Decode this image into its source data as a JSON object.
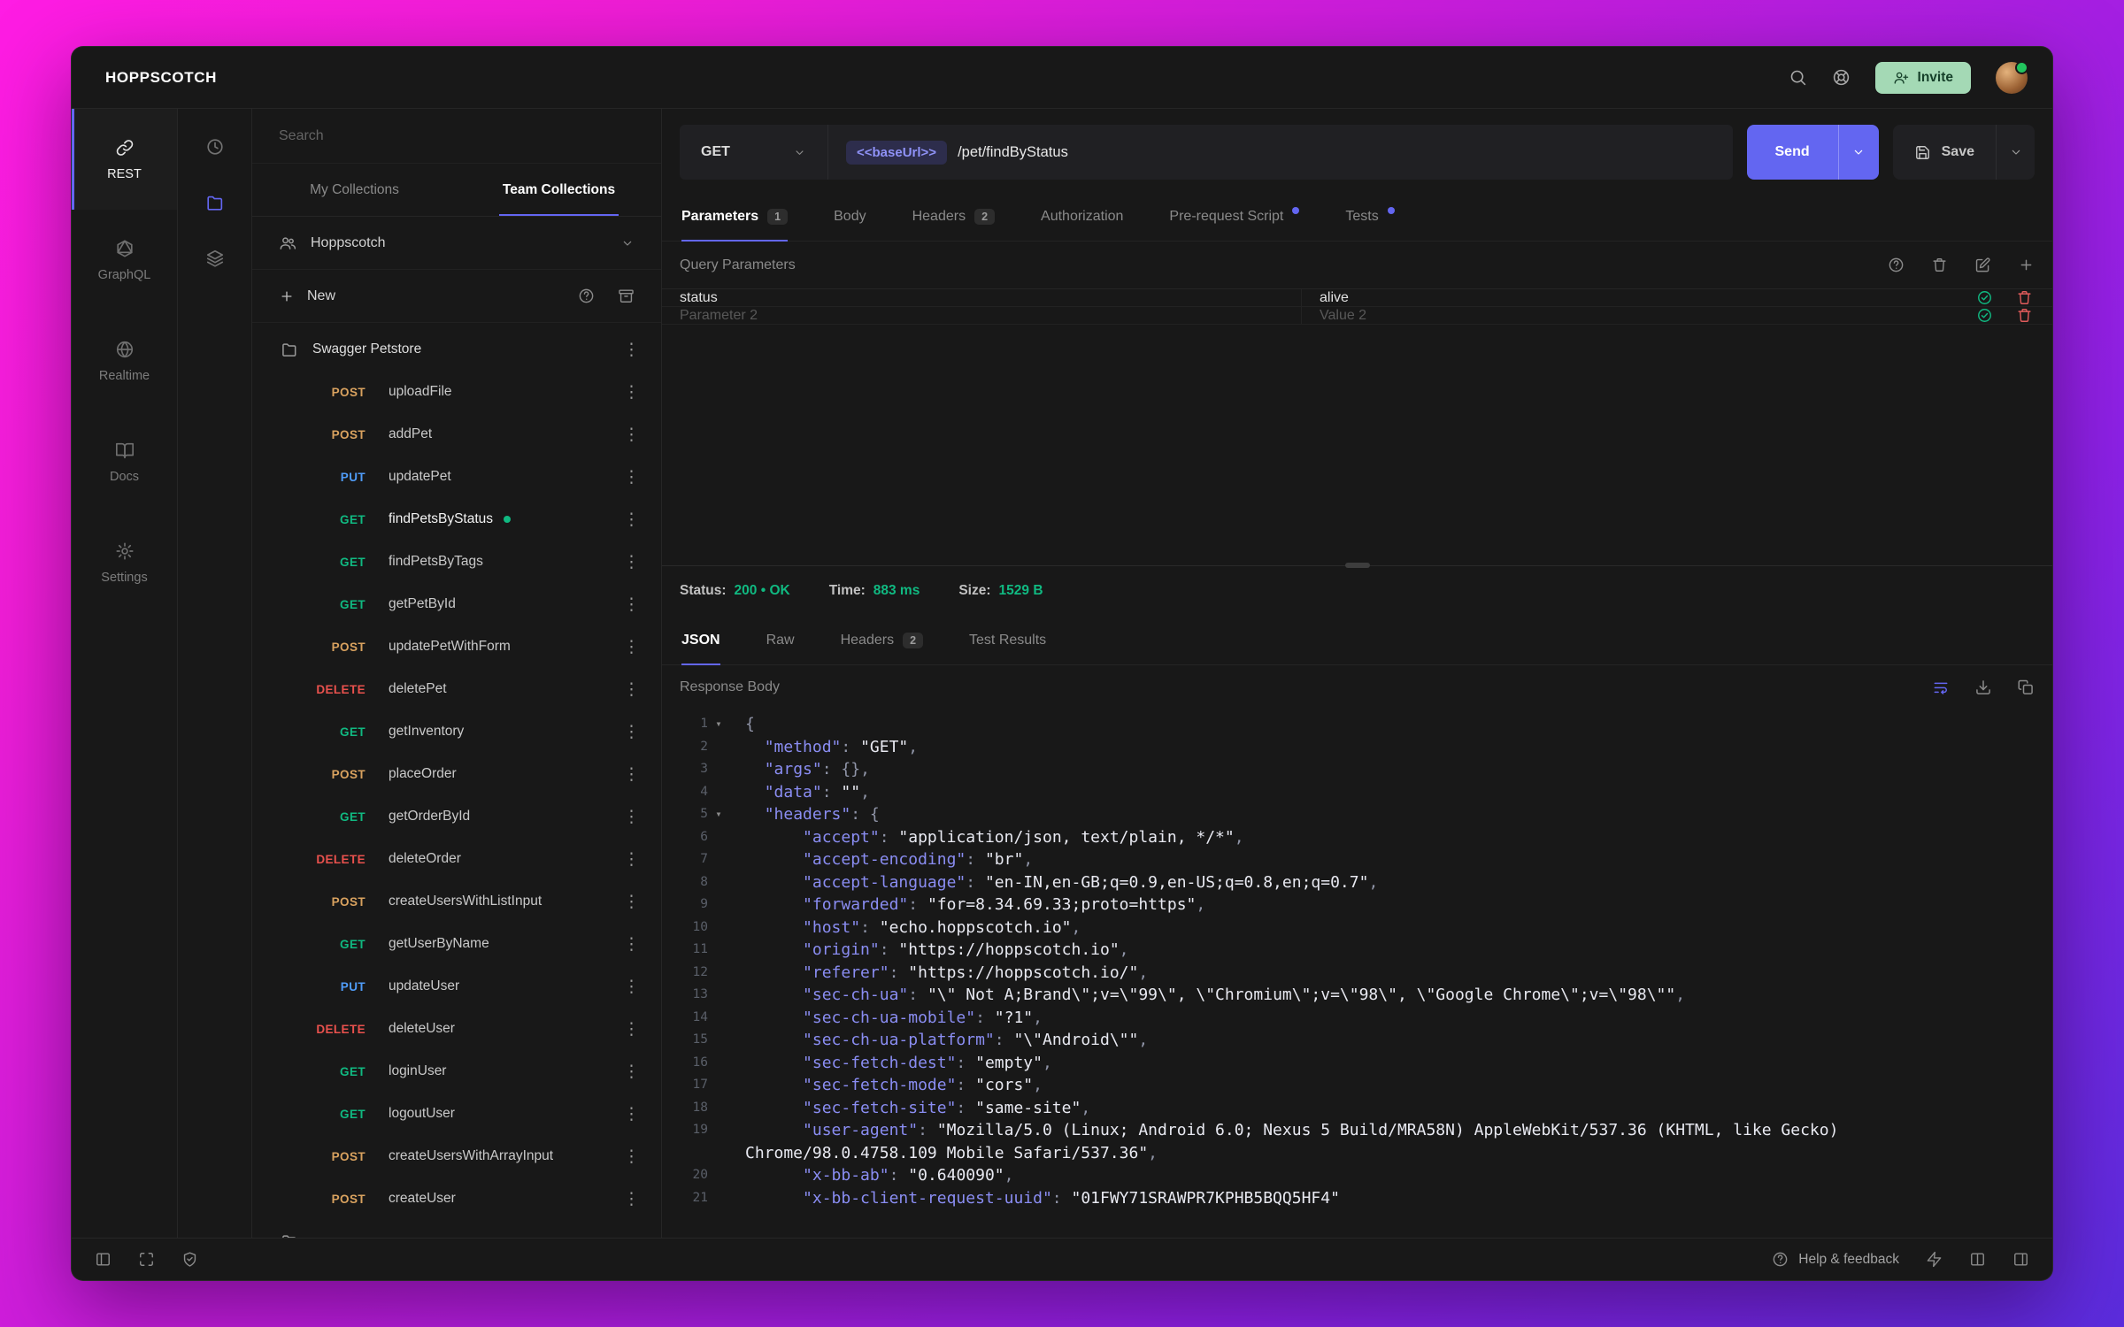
{
  "app": {
    "title": "HOPPSCOTCH"
  },
  "topbar": {
    "invite_label": "Invite",
    "icons": [
      "search-icon",
      "support-icon",
      "invite-person-add-icon",
      "avatar"
    ]
  },
  "nav": {
    "items": [
      {
        "label": "REST",
        "icon": "link-icon",
        "active": true
      },
      {
        "label": "GraphQL",
        "icon": "graphql-icon",
        "active": false
      },
      {
        "label": "Realtime",
        "icon": "globe-icon",
        "active": false
      },
      {
        "label": "Docs",
        "icon": "book-icon",
        "active": false
      },
      {
        "label": "Settings",
        "icon": "gear-icon",
        "active": false
      }
    ]
  },
  "subnav": {
    "icons": [
      {
        "name": "history-icon",
        "glyph": "clock",
        "active": false
      },
      {
        "name": "collections-folder-icon",
        "glyph": "folder",
        "active": true
      },
      {
        "name": "environments-layers-icon",
        "glyph": "layers",
        "active": false
      }
    ]
  },
  "collections": {
    "search_placeholder": "Search",
    "tabs": [
      {
        "label": "My Collections",
        "active": false
      },
      {
        "label": "Team Collections",
        "active": true
      }
    ],
    "team_name": "Hoppscotch",
    "new_label": "New",
    "header_icons": [
      "help-icon",
      "archive-icon"
    ],
    "folder_name": "Swagger Petstore",
    "requests": [
      {
        "method": "POST",
        "name": "uploadFile"
      },
      {
        "method": "POST",
        "name": "addPet"
      },
      {
        "method": "PUT",
        "name": "updatePet"
      },
      {
        "method": "GET",
        "name": "findPetsByStatus",
        "active": true
      },
      {
        "method": "GET",
        "name": "findPetsByTags"
      },
      {
        "method": "GET",
        "name": "getPetById"
      },
      {
        "method": "POST",
        "name": "updatePetWithForm"
      },
      {
        "method": "DELETE",
        "name": "deletePet"
      },
      {
        "method": "GET",
        "name": "getInventory"
      },
      {
        "method": "POST",
        "name": "placeOrder"
      },
      {
        "method": "GET",
        "name": "getOrderById"
      },
      {
        "method": "DELETE",
        "name": "deleteOrder"
      },
      {
        "method": "POST",
        "name": "createUsersWithListInput"
      },
      {
        "method": "GET",
        "name": "getUserByName"
      },
      {
        "method": "PUT",
        "name": "updateUser"
      },
      {
        "method": "DELETE",
        "name": "deleteUser"
      },
      {
        "method": "GET",
        "name": "loginUser"
      },
      {
        "method": "GET",
        "name": "logoutUser"
      },
      {
        "method": "POST",
        "name": "createUsersWithArrayInput"
      },
      {
        "method": "POST",
        "name": "createUser"
      }
    ],
    "partial_folder_visible": true
  },
  "request": {
    "method": "GET",
    "base_url_chip": "<<baseUrl>>",
    "path": "/pet/findByStatus",
    "send_label": "Send",
    "save_label": "Save",
    "tabs": [
      {
        "label": "Parameters",
        "badge": "1",
        "active": true
      },
      {
        "label": "Body"
      },
      {
        "label": "Headers",
        "badge": "2"
      },
      {
        "label": "Authorization"
      },
      {
        "label": "Pre-request Script",
        "dot": true
      },
      {
        "label": "Tests",
        "dot": true
      }
    ],
    "section_title": "Query Parameters",
    "section_icons": [
      "help-icon",
      "trash-icon",
      "edit-icon",
      "add-icon"
    ],
    "params": [
      {
        "key": "status",
        "value": "alive",
        "placeholder": false
      },
      {
        "key": "Parameter 2",
        "value": "Value 2",
        "placeholder": true
      }
    ],
    "param_row_icons": [
      "check-circle-icon",
      "trash-icon"
    ]
  },
  "response": {
    "status_label": "Status:",
    "status_value": "200 • OK",
    "time_label": "Time:",
    "time_value": "883 ms",
    "size_label": "Size:",
    "size_value": "1529 B",
    "tabs": [
      {
        "label": "JSON",
        "active": true
      },
      {
        "label": "Raw"
      },
      {
        "label": "Headers",
        "badge": "2"
      },
      {
        "label": "Test Results"
      }
    ],
    "body_label": "Response Body",
    "body_icons": [
      "wrap-lines-icon",
      "download-icon",
      "copy-icon"
    ],
    "code": [
      {
        "n": "1",
        "f": true,
        "s": [
          [
            "p",
            "{"
          ]
        ]
      },
      {
        "n": "2",
        "s": [
          [
            "w",
            "  "
          ],
          [
            "k",
            "\"method\""
          ],
          [
            "p",
            ": "
          ],
          [
            "s",
            "\"GET\""
          ],
          [
            "p",
            ","
          ]
        ]
      },
      {
        "n": "3",
        "s": [
          [
            "w",
            "  "
          ],
          [
            "k",
            "\"args\""
          ],
          [
            "p",
            ": {},"
          ]
        ]
      },
      {
        "n": "4",
        "s": [
          [
            "w",
            "  "
          ],
          [
            "k",
            "\"data\""
          ],
          [
            "p",
            ": "
          ],
          [
            "s",
            "\"\""
          ],
          [
            "p",
            ","
          ]
        ]
      },
      {
        "n": "5",
        "f": true,
        "s": [
          [
            "w",
            "  "
          ],
          [
            "k",
            "\"headers\""
          ],
          [
            "p",
            ": {"
          ]
        ]
      },
      {
        "n": "6",
        "s": [
          [
            "w",
            "      "
          ],
          [
            "k",
            "\"accept\""
          ],
          [
            "p",
            ": "
          ],
          [
            "s",
            "\"application/json, text/plain, */*\""
          ],
          [
            "p",
            ","
          ]
        ]
      },
      {
        "n": "7",
        "s": [
          [
            "w",
            "      "
          ],
          [
            "k",
            "\"accept-encoding\""
          ],
          [
            "p",
            ": "
          ],
          [
            "s",
            "\"br\""
          ],
          [
            "p",
            ","
          ]
        ]
      },
      {
        "n": "8",
        "s": [
          [
            "w",
            "      "
          ],
          [
            "k",
            "\"accept-language\""
          ],
          [
            "p",
            ": "
          ],
          [
            "s",
            "\"en-IN,en-GB;q=0.9,en-US;q=0.8,en;q=0.7\""
          ],
          [
            "p",
            ","
          ]
        ]
      },
      {
        "n": "9",
        "s": [
          [
            "w",
            "      "
          ],
          [
            "k",
            "\"forwarded\""
          ],
          [
            "p",
            ": "
          ],
          [
            "s",
            "\"for=8.34.69.33;proto=https\""
          ],
          [
            "p",
            ","
          ]
        ]
      },
      {
        "n": "10",
        "s": [
          [
            "w",
            "      "
          ],
          [
            "k",
            "\"host\""
          ],
          [
            "p",
            ": "
          ],
          [
            "s",
            "\"echo.hoppscotch.io\""
          ],
          [
            "p",
            ","
          ]
        ]
      },
      {
        "n": "11",
        "s": [
          [
            "w",
            "      "
          ],
          [
            "k",
            "\"origin\""
          ],
          [
            "p",
            ": "
          ],
          [
            "s",
            "\"https://hoppscotch.io\""
          ],
          [
            "p",
            ","
          ]
        ]
      },
      {
        "n": "12",
        "s": [
          [
            "w",
            "      "
          ],
          [
            "k",
            "\"referer\""
          ],
          [
            "p",
            ": "
          ],
          [
            "s",
            "\"https://hoppscotch.io/\""
          ],
          [
            "p",
            ","
          ]
        ]
      },
      {
        "n": "13",
        "s": [
          [
            "w",
            "      "
          ],
          [
            "k",
            "\"sec-ch-ua\""
          ],
          [
            "p",
            ": "
          ],
          [
            "s",
            "\"\\\" Not A;Brand\\\";v=\\\"99\\\", \\\"Chromium\\\";v=\\\"98\\\", \\\"Google Chrome\\\";v=\\\"98\\\"\""
          ],
          [
            "p",
            ","
          ]
        ]
      },
      {
        "n": "14",
        "s": [
          [
            "w",
            "      "
          ],
          [
            "k",
            "\"sec-ch-ua-mobile\""
          ],
          [
            "p",
            ": "
          ],
          [
            "s",
            "\"?1\""
          ],
          [
            "p",
            ","
          ]
        ]
      },
      {
        "n": "15",
        "s": [
          [
            "w",
            "      "
          ],
          [
            "k",
            "\"sec-ch-ua-platform\""
          ],
          [
            "p",
            ": "
          ],
          [
            "s",
            "\"\\\"Android\\\"\""
          ],
          [
            "p",
            ","
          ]
        ]
      },
      {
        "n": "16",
        "s": [
          [
            "w",
            "      "
          ],
          [
            "k",
            "\"sec-fetch-dest\""
          ],
          [
            "p",
            ": "
          ],
          [
            "s",
            "\"empty\""
          ],
          [
            "p",
            ","
          ]
        ]
      },
      {
        "n": "17",
        "s": [
          [
            "w",
            "      "
          ],
          [
            "k",
            "\"sec-fetch-mode\""
          ],
          [
            "p",
            ": "
          ],
          [
            "s",
            "\"cors\""
          ],
          [
            "p",
            ","
          ]
        ]
      },
      {
        "n": "18",
        "s": [
          [
            "w",
            "      "
          ],
          [
            "k",
            "\"sec-fetch-site\""
          ],
          [
            "p",
            ": "
          ],
          [
            "s",
            "\"same-site\""
          ],
          [
            "p",
            ","
          ]
        ]
      },
      {
        "n": "19",
        "s": [
          [
            "w",
            "      "
          ],
          [
            "k",
            "\"user-agent\""
          ],
          [
            "p",
            ": "
          ],
          [
            "s",
            "\"Mozilla/5.0 (Linux; Android 6.0; Nexus 5 Build/MRA58N) AppleWebKit/537.36 (KHTML, like Gecko) Chrome/98.0.4758.109 Mobile Safari/537.36\""
          ],
          [
            "p",
            ","
          ]
        ]
      },
      {
        "n": "20",
        "s": [
          [
            "w",
            "      "
          ],
          [
            "k",
            "\"x-bb-ab\""
          ],
          [
            "p",
            ": "
          ],
          [
            "s",
            "\"0.640090\""
          ],
          [
            "p",
            ","
          ]
        ]
      },
      {
        "n": "21",
        "s": [
          [
            "w",
            "      "
          ],
          [
            "k",
            "\"x-bb-client-request-uuid\""
          ],
          [
            "p",
            ": "
          ],
          [
            "s",
            "\"01FWY71SRAWPR7KPHB5BQQ5HF4\""
          ]
        ]
      }
    ]
  },
  "statusbar": {
    "help_label": "Help & feedback",
    "left_icons": [
      "panel-left-icon",
      "expand-icon",
      "shield-check-icon"
    ],
    "right_icons": [
      "help-icon",
      "zap-icon",
      "columns-icon",
      "panel-right-icon"
    ]
  },
  "colors": {
    "accent": "#6366f1",
    "success_green": "#10b981",
    "method_get": "#10b981",
    "method_post": "#d9a25f",
    "method_put": "#4f9cf8",
    "method_delete": "#e8514d",
    "json_key": "#8a8df2",
    "json_value": "#e8e9f1",
    "window_bg": "#181818"
  }
}
